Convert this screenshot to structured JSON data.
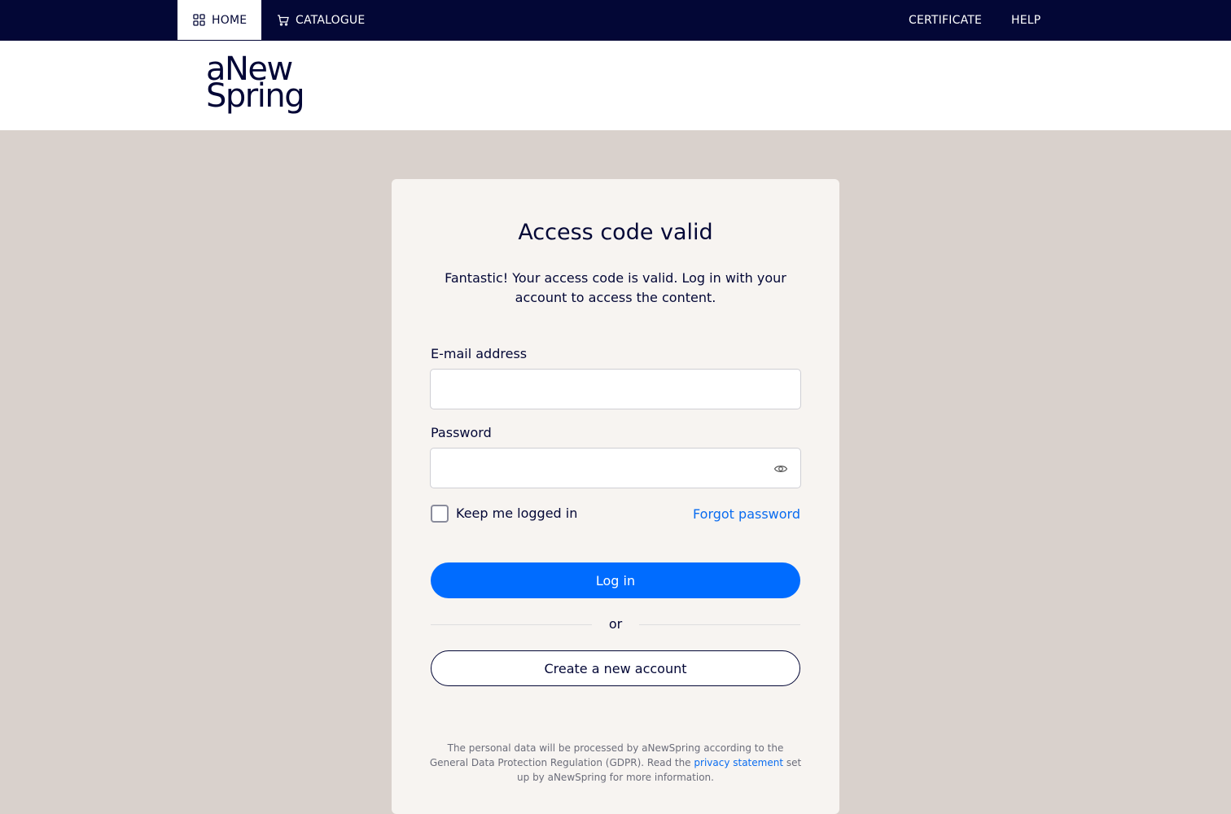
{
  "nav": {
    "home": "HOME",
    "catalogue": "CATALOGUE",
    "certificate": "CERTIFICATE",
    "help": "HELP"
  },
  "logo": {
    "line1": "aNew",
    "line2": "Spring"
  },
  "login": {
    "title": "Access code valid",
    "subtitle": "Fantastic! Your access code is valid. Log in with your account to access the content.",
    "email_label": "E-mail address",
    "email_value": "",
    "password_label": "Password",
    "password_value": "",
    "keep_logged_in": "Keep me logged in",
    "keep_logged_in_checked": false,
    "forgot_password": "Forgot password",
    "login_button": "Log in",
    "or": "or",
    "create_account": "Create a new account"
  },
  "privacy": {
    "text_before": "The personal data will be processed by aNewSpring according to the General Data Protection Regulation (GDPR). Read the ",
    "link": "privacy statement",
    "text_after": " set up by aNewSpring for more information."
  },
  "colors": {
    "navy": "#030736",
    "accent_blue": "#006cff",
    "link_blue": "#0a6cf0",
    "page_bg": "#d9d1cc",
    "card_bg": "#f7f4f1"
  }
}
